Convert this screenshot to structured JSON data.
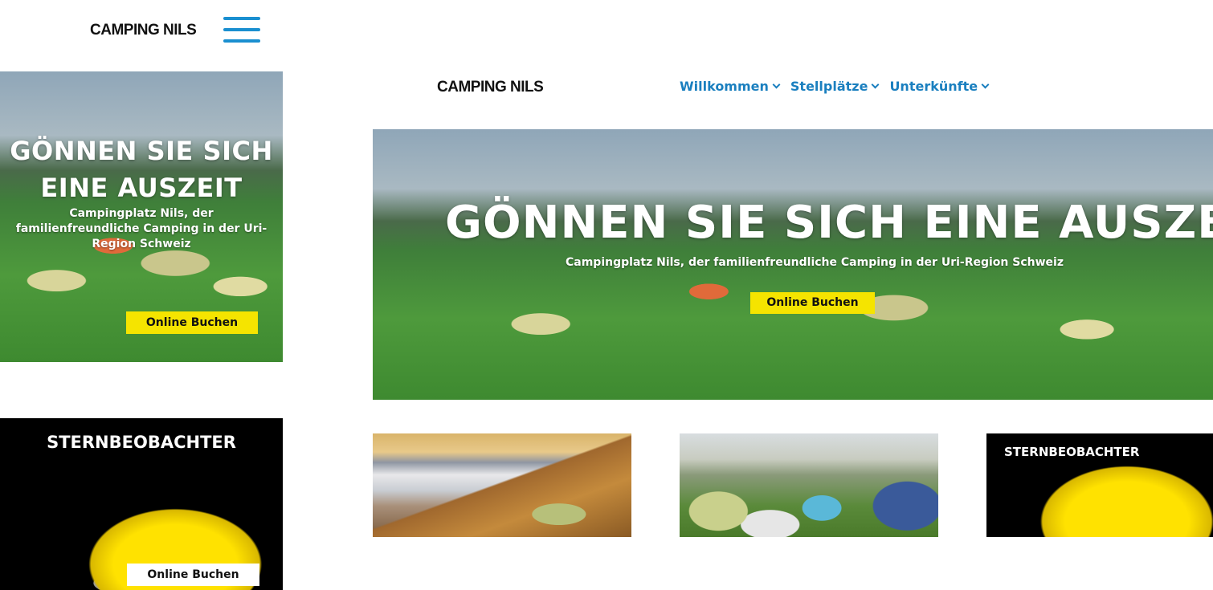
{
  "brand": {
    "logo_text": "CAMPING NILS"
  },
  "nav": {
    "items": [
      {
        "label": "Willkommen"
      },
      {
        "label": "Stellplätze"
      },
      {
        "label": "Unterkünfte"
      }
    ]
  },
  "hero": {
    "title": "GÖNNEN SIE SICH EINE AUSZEIT",
    "mobile_title": "GÖNNEN SIE SICH EINE AUSZEIT",
    "subtitle": "Campingplatz Nils, der familienfreundliche Camping in der Uri-Region Schweiz",
    "cta_label": "Online Buchen"
  },
  "stargazer": {
    "title": "STERNBEOBACHTER",
    "cta_label": "Online Buchen"
  },
  "colors": {
    "accent_blue": "#1a7fbf",
    "cta_yellow": "#f5e400"
  }
}
